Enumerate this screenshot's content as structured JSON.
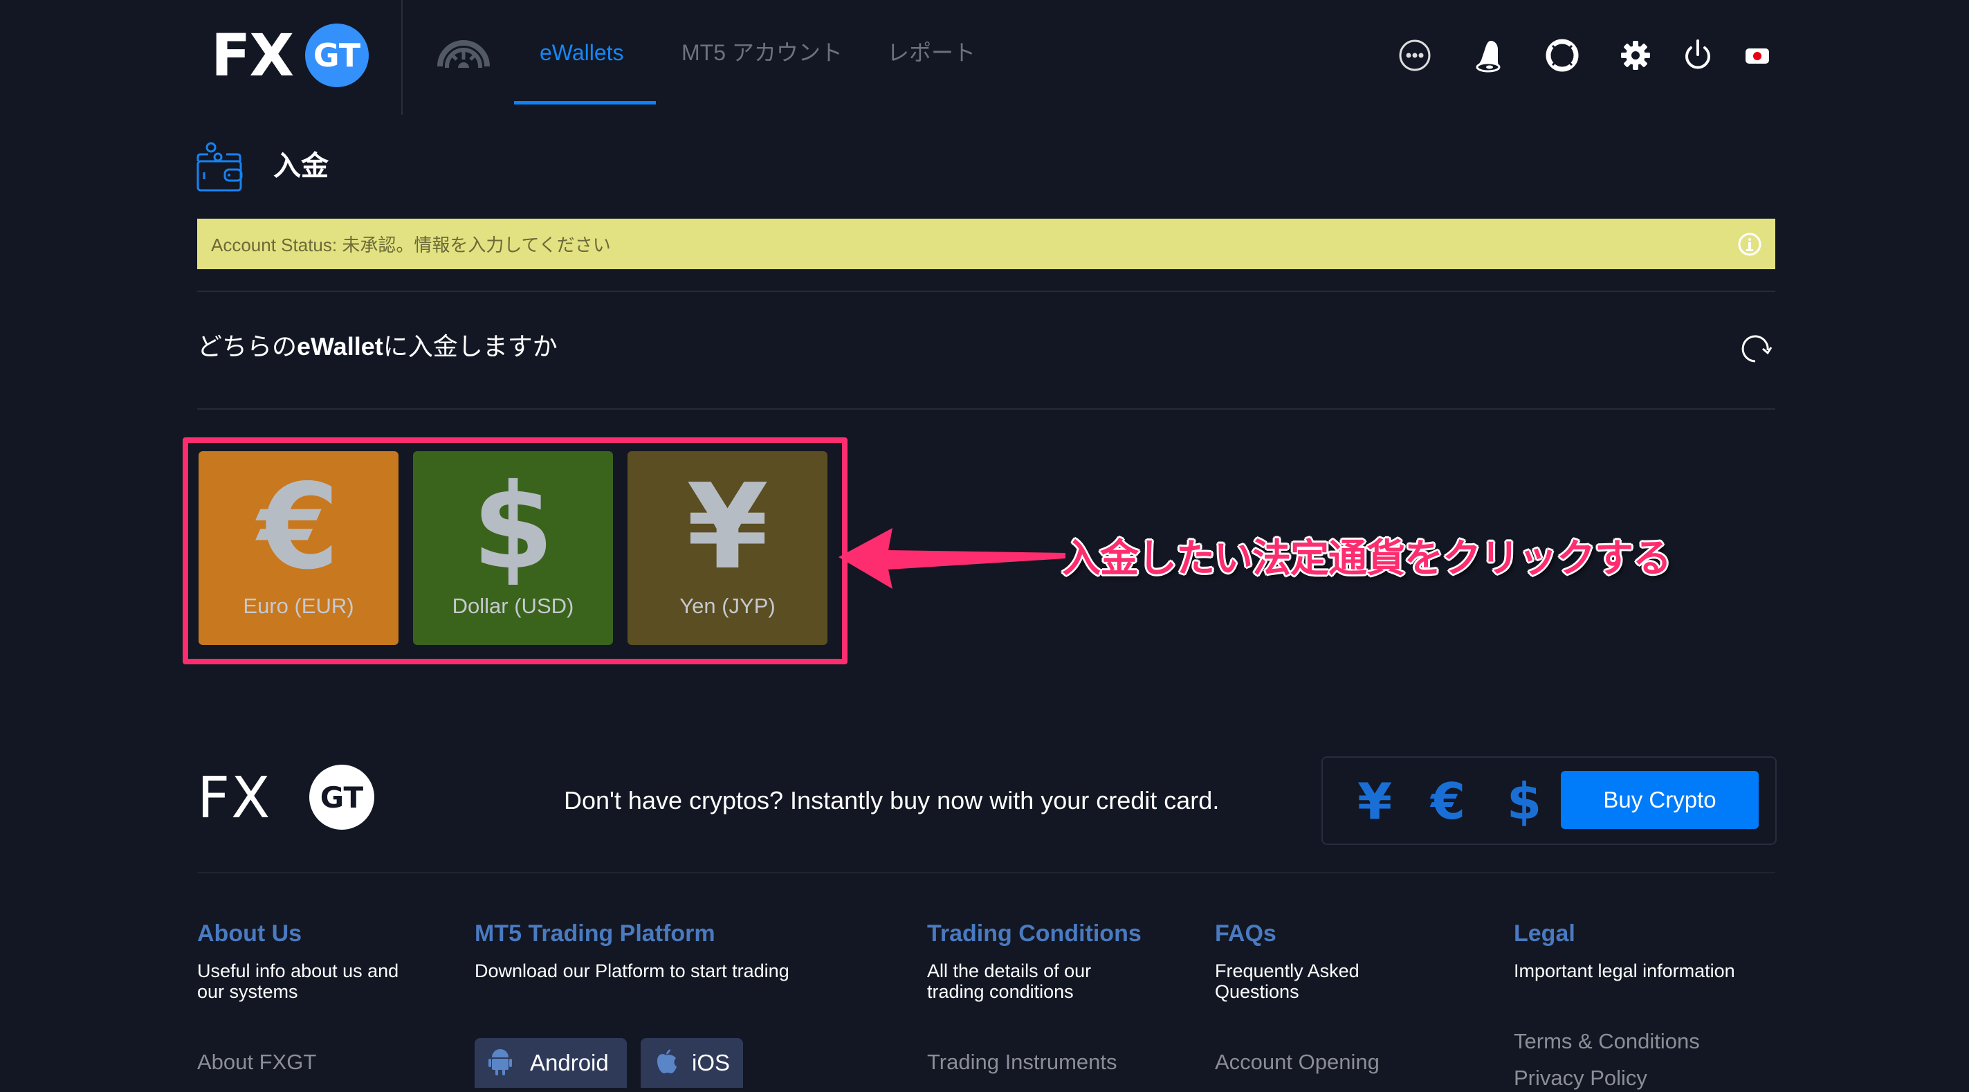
{
  "header": {
    "logo": {
      "left": "FX",
      "badge": "GT"
    },
    "tabs": [
      {
        "label": "eWallets",
        "active": true
      },
      {
        "label": "MT5 アカウント",
        "active": false
      },
      {
        "label": "レポート",
        "active": false
      }
    ],
    "icons": [
      "chat-icon",
      "bell-icon",
      "lifebuoy-icon",
      "gear-icon",
      "power-icon",
      "japan-flag-icon"
    ]
  },
  "page": {
    "title": "入金",
    "status": "Account Status: 未承認。情報を入力してください",
    "question_prefix": "どちらの",
    "question_bold": "eWallet",
    "question_suffix": "に入金しますか"
  },
  "currencies": [
    {
      "symbol": "€",
      "label": "Euro (EUR)",
      "color": "#c8781e"
    },
    {
      "symbol": "$",
      "label": "Dollar (USD)",
      "color": "#3a641c"
    },
    {
      "symbol": "¥",
      "label": "Yen (JYP)",
      "color": "#5a4e22"
    }
  ],
  "annotation": {
    "text": "入金したい法定通貨をクリックする",
    "color": "#fd2d6f"
  },
  "footer": {
    "logo": {
      "left": "FX",
      "badge": "GT"
    },
    "cta_text": "Don't have cryptos? Instantly buy now with your credit card.",
    "cta_symbols": [
      "¥",
      "€",
      "$"
    ],
    "buy_button": "Buy Crypto",
    "columns": [
      {
        "title": "About Us",
        "desc": "Useful info about us and our systems",
        "links": [
          "About FXGT"
        ]
      },
      {
        "title": "MT5 Trading Platform",
        "desc": "Download our Platform to start trading",
        "buttons": [
          "Android",
          "iOS"
        ]
      },
      {
        "title": "Trading Conditions",
        "desc": "All the details of our trading conditions",
        "links": [
          "Trading Instruments"
        ]
      },
      {
        "title": "FAQs",
        "desc": "Frequently Asked Questions",
        "links": [
          "Account Opening"
        ]
      },
      {
        "title": "Legal",
        "desc": "Important legal information",
        "links": [
          "Terms & Conditions",
          "Privacy Policy"
        ]
      }
    ]
  },
  "colors": {
    "background": "#121723",
    "accent": "#0d82f9",
    "status_bar": "#e3e282",
    "highlight": "#fd2d6f"
  }
}
